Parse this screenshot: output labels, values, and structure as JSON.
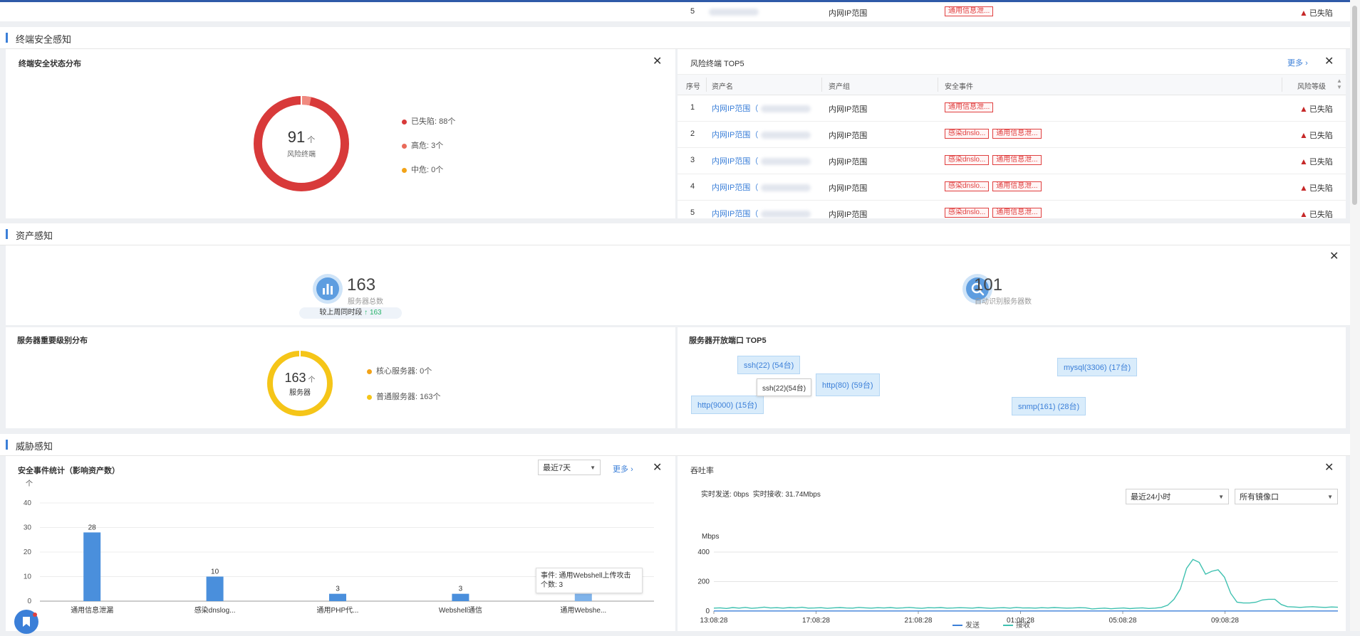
{
  "top_row": {
    "index": "5",
    "group": "内网IP范围",
    "tag": "通用信息泄...",
    "status": "已失陷"
  },
  "sections": {
    "terminal": "终端安全感知",
    "asset": "资产感知",
    "threat": "威胁感知"
  },
  "terminal_dist": {
    "title": "终端安全状态分布",
    "center_value": "91",
    "center_unit": "个",
    "center_label": "风险终端",
    "legend": [
      "已失陷: 88个",
      "高危: 3个",
      "中危: 0个"
    ],
    "colors": [
      "#d83a3a",
      "#e96a5a",
      "#f2a318"
    ],
    "values": [
      88,
      3,
      0
    ]
  },
  "risk_top5": {
    "title": "风险终端 TOP5",
    "more": "更多",
    "headers": [
      "序号",
      "资产名",
      "资产组",
      "安全事件",
      "风险等级"
    ],
    "rows": [
      {
        "idx": "1",
        "name": "内网IP范围（",
        "group": "内网IP范围",
        "tags": [
          "通用信息泄..."
        ],
        "status": "已失陷"
      },
      {
        "idx": "2",
        "name": "内网IP范围（",
        "group": "内网IP范围",
        "tags": [
          "感染dnslo...",
          "通用信息泄..."
        ],
        "status": "已失陷"
      },
      {
        "idx": "3",
        "name": "内网IP范围（",
        "group": "内网IP范围",
        "tags": [
          "感染dnslo...",
          "通用信息泄..."
        ],
        "status": "已失陷"
      },
      {
        "idx": "4",
        "name": "内网IP范围（",
        "group": "内网IP范围",
        "tags": [
          "感染dnslo...",
          "通用信息泄..."
        ],
        "status": "已失陷"
      },
      {
        "idx": "5",
        "name": "内网IP范围（",
        "group": "内网IP范围",
        "tags": [
          "感染dnslo...",
          "通用信息泄..."
        ],
        "status": "已失陷"
      }
    ]
  },
  "asset": {
    "server_total": "163",
    "server_total_label": "服务器总数",
    "compare_label": "较上周同时段",
    "compare_value": "163",
    "auto_identified": "101",
    "auto_identified_label": "自动识别服务器数"
  },
  "server_dist": {
    "title": "服务器重要级别分布",
    "center_value": "163",
    "center_unit": "个",
    "center_label": "服务器",
    "legend": [
      "核心服务器: 0个",
      "普通服务器: 163个"
    ],
    "colors": [
      "#f2a318",
      "#f5c518"
    ]
  },
  "ports_top5": {
    "title": "服务器开放端口 TOP5",
    "items": [
      "ssh(22) (54台)",
      "http(80) (59台)",
      "mysql(3306) (17台)",
      "http(9000) (15台)",
      "snmp(161) (28台)"
    ],
    "tooltip": "ssh(22)(54台)"
  },
  "events": {
    "title": "安全事件统计（影响资产数）",
    "select": "最近7天",
    "more": "更多",
    "unit": "个",
    "tooltip_line1": "事件: 通用Webshell上传攻击",
    "tooltip_line2": "个数: 3"
  },
  "chart_data": [
    {
      "type": "bar",
      "categories": [
        "通用信息泄漏",
        "感染dnslog...",
        "通用PHP代...",
        "Webshell通信",
        "通用Webshe..."
      ],
      "values": [
        28,
        10,
        3,
        3,
        3
      ],
      "ylabel": "个",
      "ylim": [
        0,
        40
      ],
      "yticks": [
        0,
        10,
        20,
        30,
        40
      ],
      "color": "#4a8fdc"
    },
    {
      "type": "line",
      "title": "吞吐率",
      "ylabel": "Mbps",
      "ylim": [
        0,
        400
      ],
      "yticks": [
        0,
        200,
        400
      ],
      "xticks": [
        "13:08:28",
        "17:08:28",
        "21:08:28",
        "01:08:28",
        "05:08:28",
        "09:08:28"
      ],
      "series": [
        {
          "name": "发送",
          "color": "#3b7fd8",
          "values": [
            1,
            1,
            1,
            1,
            1,
            1,
            1,
            1,
            1,
            1,
            1,
            1,
            1,
            1,
            1,
            1,
            1,
            1,
            1,
            1,
            1,
            1,
            1,
            1,
            1,
            1,
            1,
            1,
            1,
            1,
            1,
            1,
            1,
            1,
            1,
            1,
            1,
            1,
            1,
            1,
            1,
            1,
            1,
            1,
            1,
            1,
            1,
            1,
            1,
            1,
            1,
            1,
            1,
            1,
            1,
            1,
            1,
            1,
            1,
            1,
            1,
            1,
            1,
            1,
            1,
            1,
            1,
            1,
            1,
            1,
            1,
            1,
            1,
            1,
            1,
            1,
            1,
            1,
            1,
            1,
            1,
            1,
            1,
            1,
            1,
            1,
            1,
            1,
            1,
            1,
            1,
            1,
            1,
            1,
            1,
            1,
            1,
            1,
            1,
            1
          ]
        },
        {
          "name": "接收",
          "color": "#3fc1b0",
          "values": [
            20,
            22,
            18,
            24,
            20,
            25,
            19,
            22,
            27,
            21,
            23,
            20,
            24,
            22,
            26,
            20,
            21,
            23,
            19,
            22,
            24,
            21,
            20,
            25,
            22,
            20,
            23,
            21,
            24,
            20,
            22,
            25,
            21,
            19,
            23,
            22,
            24,
            20,
            21,
            23,
            22,
            20,
            24,
            21,
            19,
            22,
            23,
            20,
            25,
            21,
            22,
            20,
            23,
            21,
            24,
            22,
            20,
            21,
            23,
            22,
            15,
            18,
            20,
            16,
            19,
            21,
            17,
            20,
            22,
            18,
            20,
            25,
            40,
            80,
            150,
            290,
            350,
            330,
            250,
            270,
            280,
            230,
            120,
            60,
            55,
            55,
            60,
            75,
            80,
            80,
            45,
            30,
            28,
            25,
            28,
            30,
            27,
            25,
            28,
            26
          ]
        }
      ]
    }
  ],
  "throughput": {
    "title": "吞吐率",
    "realtime": "实时发送: 0bps  实时接收: 31.74Mbps",
    "select1": "最近24小时",
    "select2": "所有镜像口"
  }
}
